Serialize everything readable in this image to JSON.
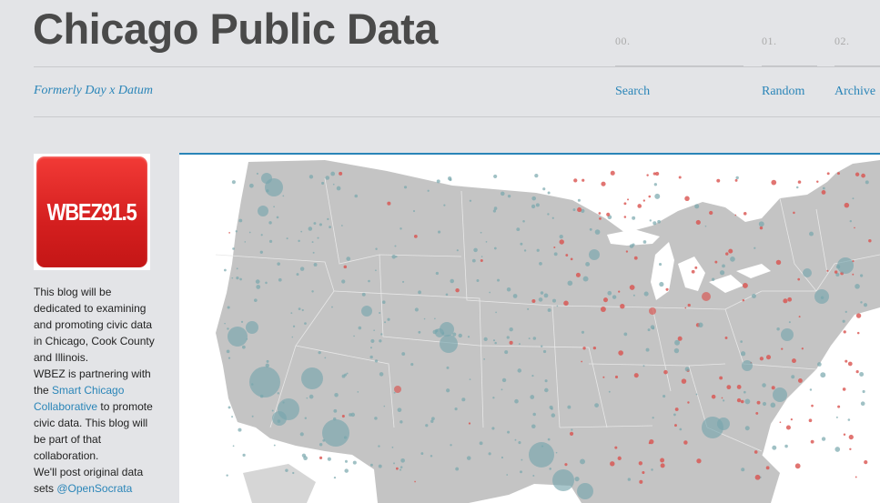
{
  "header": {
    "title": "Chicago Public Data",
    "tagline": "Formerly Day x Datum"
  },
  "nav": [
    {
      "num": "00.",
      "label": "Search"
    },
    {
      "num": "01.",
      "label": "Random"
    },
    {
      "num": "02.",
      "label": "Archive"
    }
  ],
  "logo": {
    "text": "WBEZ91.5"
  },
  "sidebar": {
    "intro": "This blog will be dedicated to examining and promoting civic data in Chicago, Cook County and Illinois.",
    "partner_pre": "WBEZ is partnering with the",
    "partner_link": "Smart Chicago Collaborative",
    "partner_post": "to promote civic data. This blog will be part of that collaboration.",
    "post_pre": "We'll post original data sets",
    "post_link": "@OpenSocrata"
  },
  "colors": {
    "accent": "#2a85b8",
    "land": "#c4c4c4",
    "teal_dot": "#78a6ad",
    "red_dot": "#d9534f"
  }
}
